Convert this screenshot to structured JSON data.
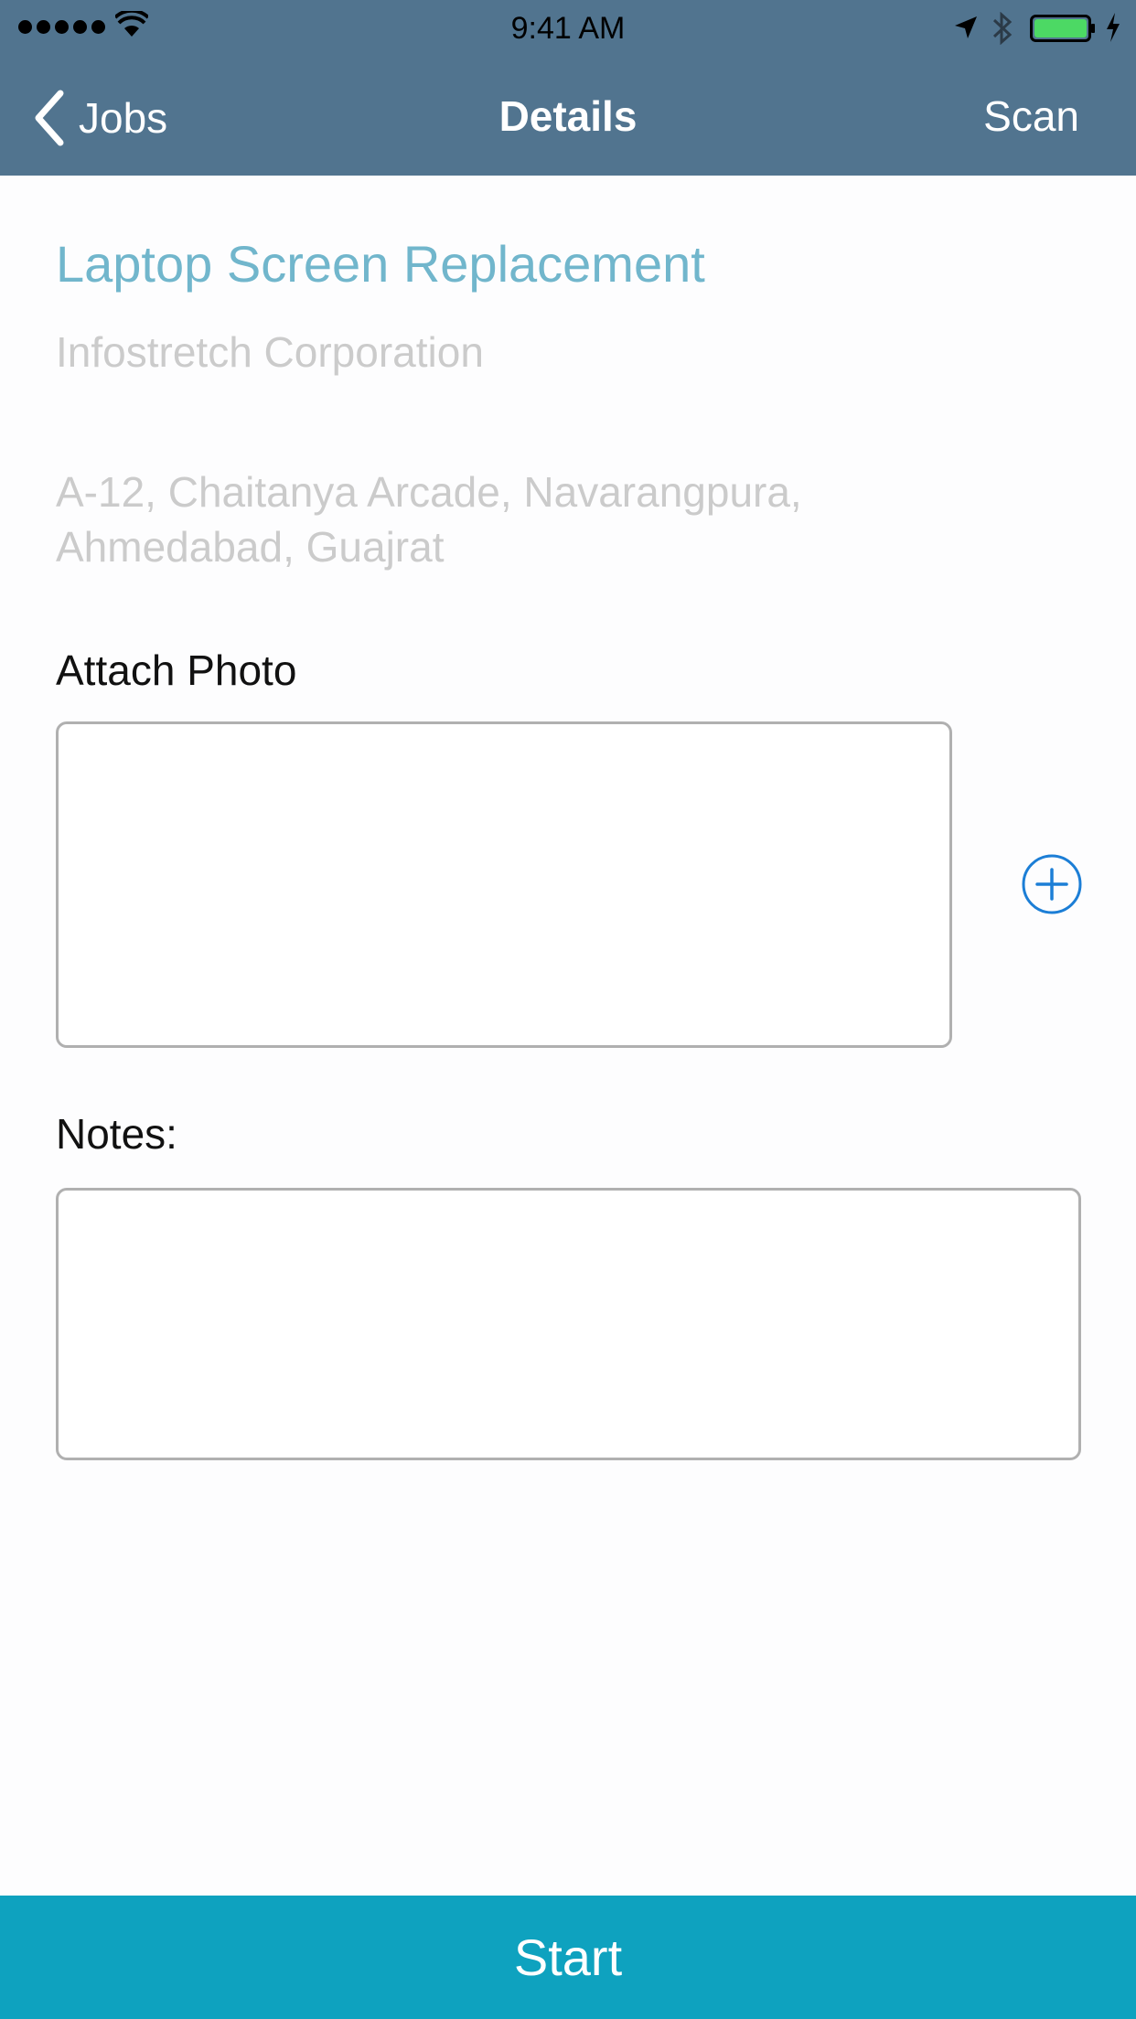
{
  "status_bar": {
    "time": "9:41 AM",
    "icons": [
      "signal-dots",
      "wifi-icon",
      "location-arrow-icon",
      "bluetooth-icon",
      "battery-icon",
      "charging-bolt-icon"
    ]
  },
  "nav": {
    "back_label": "Jobs",
    "title": "Details",
    "right_label": "Scan"
  },
  "job": {
    "title": "Laptop Screen Replacement",
    "company": "Infostretch Corporation",
    "address_line1": "A-12, Chaitanya Arcade, Navarangpura,",
    "address_line2": "Ahmedabad, Guajrat"
  },
  "attach": {
    "label": "Attach Photo",
    "add_icon": "plus-circle-icon"
  },
  "notes": {
    "label": "Notes:",
    "value": ""
  },
  "actions": {
    "start_label": "Start"
  },
  "colors": {
    "nav_background": "#51748f",
    "title_accent": "#71b6cc",
    "muted_text": "#cbcbcb",
    "start_button": "#0ea2bf",
    "add_icon": "#1c7ed6",
    "battery_fill": "#4cd964"
  }
}
